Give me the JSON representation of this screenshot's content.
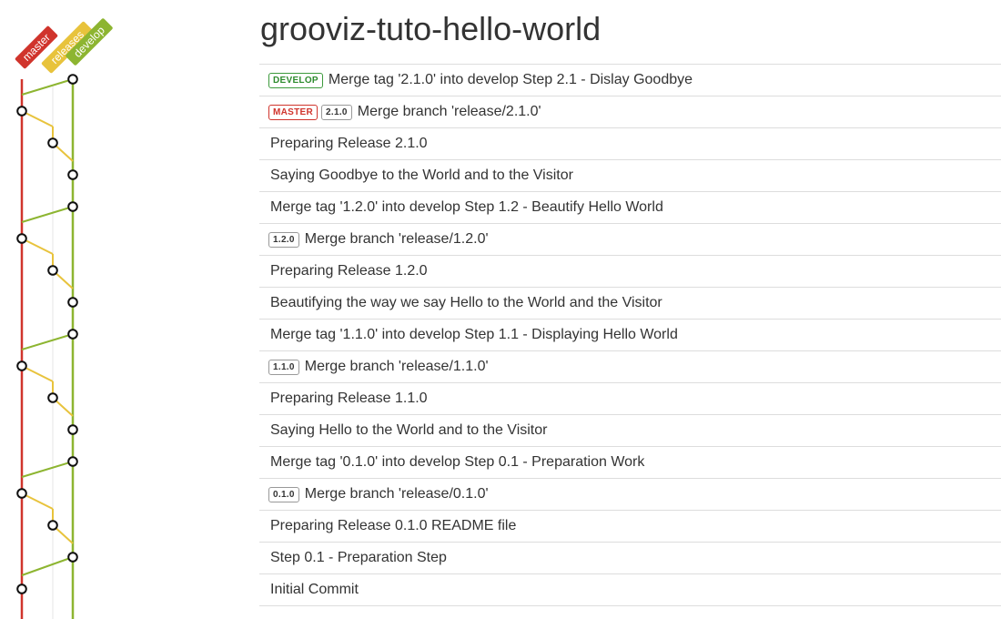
{
  "title": "grooviz-tuto-hello-world",
  "branches": [
    {
      "name": "master",
      "color": "#d0342c"
    },
    {
      "name": "releases",
      "color": "#e8c33c"
    },
    {
      "name": "develop",
      "color": "#8db531"
    }
  ],
  "commits": [
    {
      "lane": "develop",
      "tags": [
        {
          "text": "DEVELOP",
          "kind": "develop"
        }
      ],
      "message": "Merge tag '2.1.0' into develop Step 2.1 - Dislay Goodbye"
    },
    {
      "lane": "master",
      "tags": [
        {
          "text": "MASTER",
          "kind": "master"
        },
        {
          "text": "2.1.0",
          "kind": "version"
        }
      ],
      "message": "Merge branch 'release/2.1.0'"
    },
    {
      "lane": "releases",
      "tags": [],
      "message": "Preparing Release 2.1.0"
    },
    {
      "lane": "develop",
      "tags": [],
      "message": "Saying Goodbye to the World and to the Visitor"
    },
    {
      "lane": "develop",
      "tags": [],
      "message": "Merge tag '1.2.0' into develop Step 1.2 - Beautify Hello World"
    },
    {
      "lane": "master",
      "tags": [
        {
          "text": "1.2.0",
          "kind": "version"
        }
      ],
      "message": "Merge branch 'release/1.2.0'"
    },
    {
      "lane": "releases",
      "tags": [],
      "message": "Preparing Release 1.2.0"
    },
    {
      "lane": "develop",
      "tags": [],
      "message": "Beautifying the way we say Hello to the World and the Visitor"
    },
    {
      "lane": "develop",
      "tags": [],
      "message": "Merge tag '1.1.0' into develop Step 1.1 - Displaying Hello World"
    },
    {
      "lane": "master",
      "tags": [
        {
          "text": "1.1.0",
          "kind": "version"
        }
      ],
      "message": "Merge branch 'release/1.1.0'"
    },
    {
      "lane": "releases",
      "tags": [],
      "message": "Preparing Release 1.1.0"
    },
    {
      "lane": "develop",
      "tags": [],
      "message": "Saying Hello to the World and to the Visitor"
    },
    {
      "lane": "develop",
      "tags": [],
      "message": "Merge tag '0.1.0' into develop Step 0.1 - Preparation Work"
    },
    {
      "lane": "master",
      "tags": [
        {
          "text": "0.1.0",
          "kind": "version"
        }
      ],
      "message": "Merge branch 'release/0.1.0'"
    },
    {
      "lane": "releases",
      "tags": [],
      "message": "Preparing Release 0.1.0 README file"
    },
    {
      "lane": "develop",
      "tags": [],
      "message": "Step 0.1 - Preparation Step"
    },
    {
      "lane": "master",
      "tags": [],
      "message": "Initial Commit"
    }
  ]
}
